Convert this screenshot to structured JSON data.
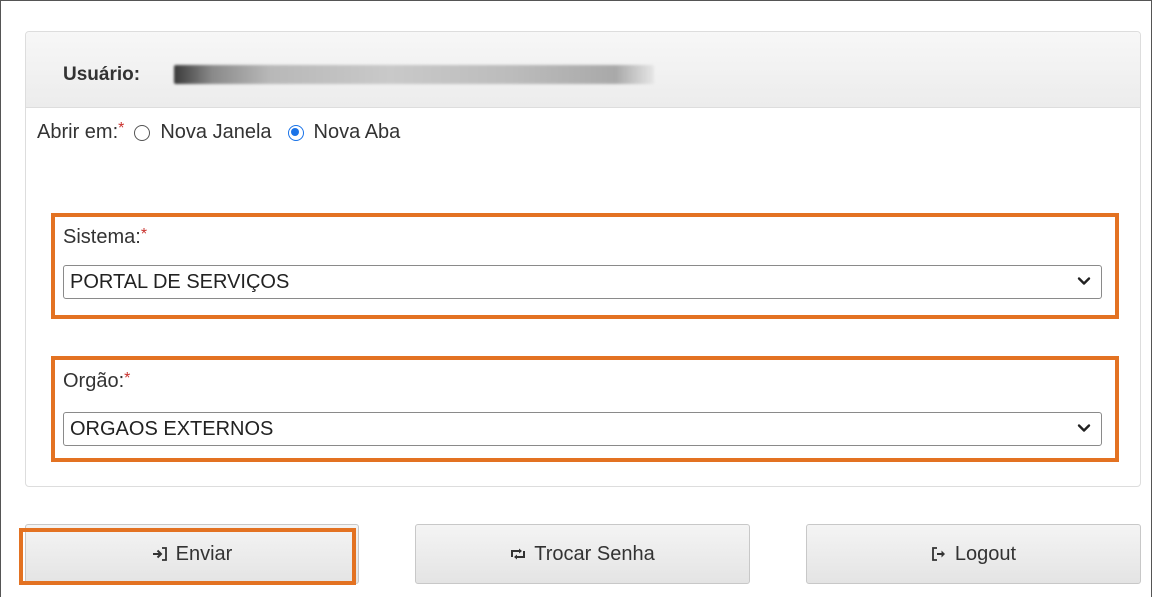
{
  "header": {
    "user_label": "Usuário:",
    "user_value_redacted": true
  },
  "open_in": {
    "label": "Abrir em:",
    "required_mark": "*",
    "options": [
      {
        "label": "Nova Janela",
        "checked": false
      },
      {
        "label": "Nova Aba",
        "checked": true
      }
    ]
  },
  "sistema": {
    "label": "Sistema:",
    "required_mark": "*",
    "selected": "PORTAL DE SERVIÇOS"
  },
  "orgao": {
    "label": "Orgão:",
    "required_mark": "*",
    "selected": "ORGAOS EXTERNOS"
  },
  "buttons": {
    "enviar": "Enviar",
    "trocar_senha": "Trocar Senha",
    "logout": "Logout"
  },
  "colors": {
    "highlight": "#e37222",
    "required": "#c9302c",
    "radio_checked": "#1a73e8"
  },
  "icons": {
    "enviar": "sign-in-icon",
    "trocar_senha": "retweet-icon",
    "logout": "sign-out-icon",
    "select": "chevron-down-icon"
  }
}
